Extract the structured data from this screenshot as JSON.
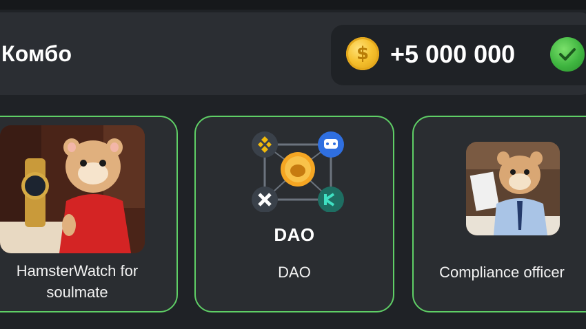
{
  "combo": {
    "title": "Комбо",
    "reward_amount": "+5 000 000",
    "reward_icon": "coin-icon",
    "status_icon": "check-icon",
    "colors": {
      "panel": "#2b2e33",
      "accent_border": "#5fcf66",
      "coin": "#f6c12f",
      "check": "#3fb540"
    }
  },
  "cards": [
    {
      "label": "HamsterWatch for soulmate",
      "image": "hamster-in-red-dress-with-gold-watch"
    },
    {
      "label": "DAO",
      "image_caption": "DAO",
      "image": "dao-network-graphic"
    },
    {
      "label": "Compliance officer",
      "image": "hamster-office-worker-with-document"
    }
  ]
}
